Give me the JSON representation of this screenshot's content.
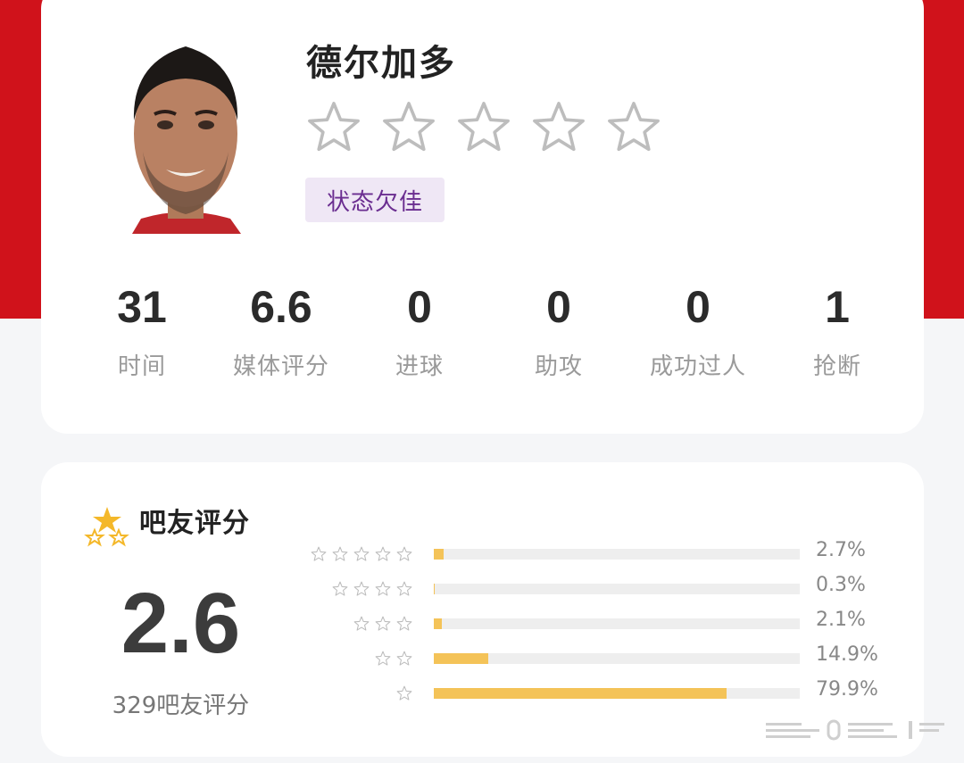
{
  "player": {
    "name": "德尔加多",
    "star_rating": 0,
    "star_max": 5,
    "status": "状态欠佳"
  },
  "stats": [
    {
      "value": "31",
      "label": "时间"
    },
    {
      "value": "6.6",
      "label": "媒体评分"
    },
    {
      "value": "0",
      "label": "进球"
    },
    {
      "value": "0",
      "label": "助攻"
    },
    {
      "value": "0",
      "label": "成功过人"
    },
    {
      "value": "1",
      "label": "抢断"
    }
  ],
  "fan_rating": {
    "title": "吧友评分",
    "score": "2.6",
    "count_text": "329吧友评分",
    "distribution": [
      {
        "stars": 5,
        "percent_text": "2.7%",
        "percent": 2.7
      },
      {
        "stars": 4,
        "percent_text": "0.3%",
        "percent": 0.3
      },
      {
        "stars": 3,
        "percent_text": "2.1%",
        "percent": 2.1
      },
      {
        "stars": 2,
        "percent_text": "14.9%",
        "percent": 14.9
      },
      {
        "stars": 1,
        "percent_text": "79.9%",
        "percent": 79.9
      }
    ]
  },
  "colors": {
    "brand_red": "#d0121b",
    "bar_fill": "#f4c358",
    "status_bg": "#efe7f5",
    "status_text": "#6a2d90"
  }
}
